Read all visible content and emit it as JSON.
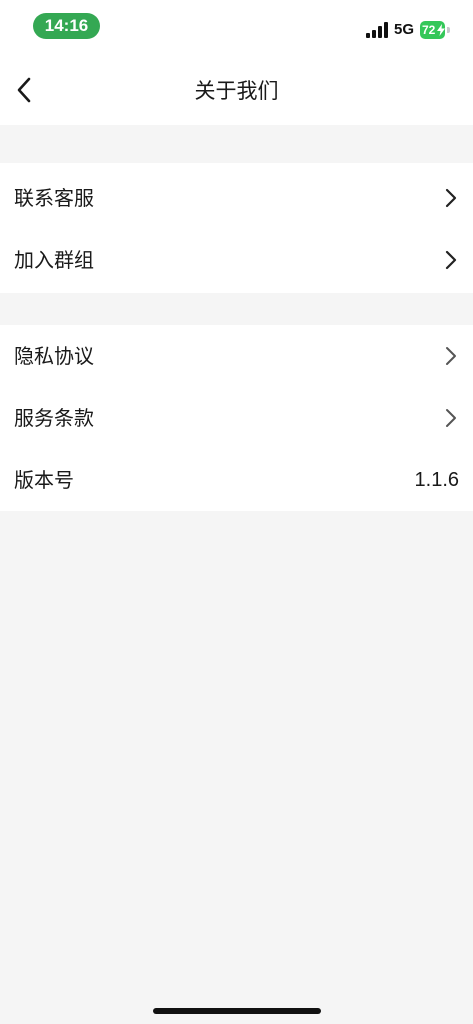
{
  "status_bar": {
    "time": "14:16",
    "network": "5G",
    "battery_level": "72",
    "battery_color": "#34c759",
    "time_pill_color": "#34a853",
    "icons": [
      "signal-icon",
      "charging-bolt-icon"
    ]
  },
  "nav": {
    "title": "关于我们",
    "back_icon": "chevron-left-icon"
  },
  "group1": {
    "items": [
      {
        "label": "联系客服",
        "icon": "chevron-right-icon"
      },
      {
        "label": "加入群组",
        "icon": "chevron-right-icon"
      }
    ]
  },
  "group2": {
    "items": [
      {
        "label": "隐私协议",
        "icon": "chevron-right-icon"
      },
      {
        "label": "服务条款",
        "icon": "chevron-right-icon"
      },
      {
        "label": "版本号",
        "value": "1.1.6"
      }
    ]
  }
}
